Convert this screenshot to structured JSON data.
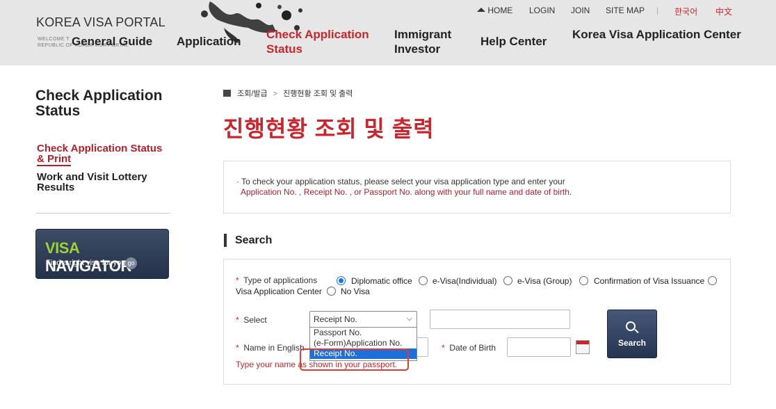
{
  "header": {
    "logo": "KOREA VISA PORTAL",
    "logo_sub_1": "WELCOME T",
    "logo_sub_2": "REPUBLIC OF KOREA VISA PORTAL",
    "util": {
      "home": "HOME",
      "login": "LOGIN",
      "join": "JOIN",
      "sitemap": "SITE MAP",
      "lang_ko": "한국어",
      "lang_zh": "中文"
    },
    "nav": {
      "general_guide": "General Guide",
      "application": "Application",
      "check_status_1": "Check Application",
      "check_status_2": "Status",
      "immigrant_1": "Immigrant",
      "immigrant_2": "Investor",
      "help_center": "Help Center",
      "kvac": "Korea Visa Application Center"
    }
  },
  "sidebar": {
    "title_1": "Check Application",
    "title_2": "Status",
    "items": [
      {
        "label_1": "Check Application Status",
        "label_2": "& Print"
      },
      {
        "label_1": "Work and Visit Lottery",
        "label_2": "Results"
      }
    ],
    "navigator": {
      "title_a": "VISA",
      "title_b": "NAVIGATOR",
      "sub": "Find a right visa for you",
      "go": "go"
    }
  },
  "breadcrumb": {
    "level1": "조회/발급",
    "sep": ">",
    "level2": "진행현황 조회 및 출력"
  },
  "page_title": "진행현황 조회 및 출력",
  "notice": {
    "line1": "· To check your application status, please select your visa application type and enter your",
    "line2": "Application No. , Receipt No. , or Passport No. along with your full name and date of birth."
  },
  "search": {
    "heading": "Search",
    "required_mark": "*",
    "type_label": "Type of applications",
    "types": [
      "Diplomatic office",
      "e-Visa(Individual)",
      "e-Visa (Group)",
      "Confirmation of Visa Issuance",
      "Visa Application Center",
      "No Visa"
    ],
    "select_label": "Select",
    "select_value": "Receipt No.",
    "select_options": [
      "Passport No.",
      "(e-Form)Application No.",
      "Receipt No."
    ],
    "name_label": "Name in English",
    "dob_label": "Date of Birth",
    "button": "Search",
    "help": "Type your name as shown in your passport."
  },
  "colors": {
    "accent": "#c8262c",
    "navy": "#2b3a55"
  }
}
